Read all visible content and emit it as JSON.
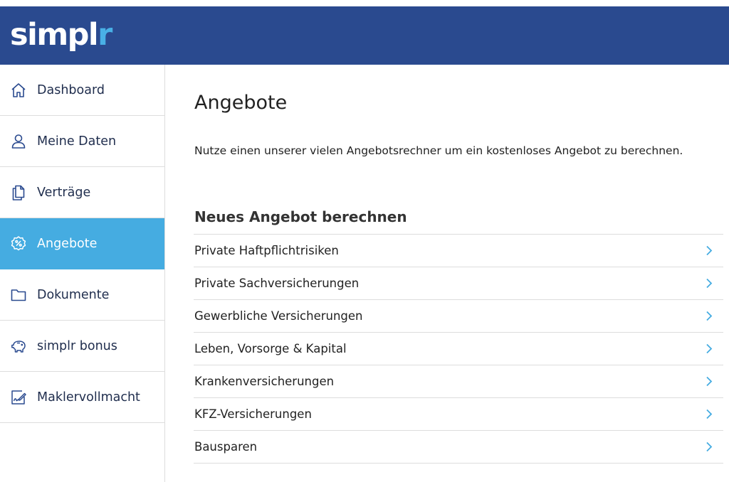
{
  "brand": {
    "logo_main": "simpl",
    "logo_accent": "r"
  },
  "sidebar": {
    "items": [
      {
        "label": "Dashboard",
        "icon": "home-icon",
        "active": false
      },
      {
        "label": "Meine Daten",
        "icon": "user-icon",
        "active": false
      },
      {
        "label": "Verträge",
        "icon": "documents-icon",
        "active": false
      },
      {
        "label": "Angebote",
        "icon": "percent-badge-icon",
        "active": true
      },
      {
        "label": "Dokumente",
        "icon": "folder-icon",
        "active": false
      },
      {
        "label": "simplr bonus",
        "icon": "piggy-bank-icon",
        "active": false
      },
      {
        "label": "Maklervollmacht",
        "icon": "signature-icon",
        "active": false
      }
    ]
  },
  "main": {
    "title": "Angebote",
    "intro": "Nutze einen unserer vielen Angebotsrechner um ein kostenloses Angebot zu berechnen.",
    "section_title": "Neues Angebot berechnen",
    "offers": [
      "Private Haftpflichtrisiken",
      "Private Sachversicherungen",
      "Gewerbliche Versicherungen",
      "Leben, Vorsorge & Kapital",
      "Krankenversicherungen",
      "KFZ-Versicherungen",
      "Bausparen"
    ]
  },
  "colors": {
    "header_bg": "#2a4a8f",
    "accent": "#45ace1",
    "logo_accent": "#49b0e6",
    "nav_text": "#1f2d4d",
    "chevron": "#45ace1"
  }
}
